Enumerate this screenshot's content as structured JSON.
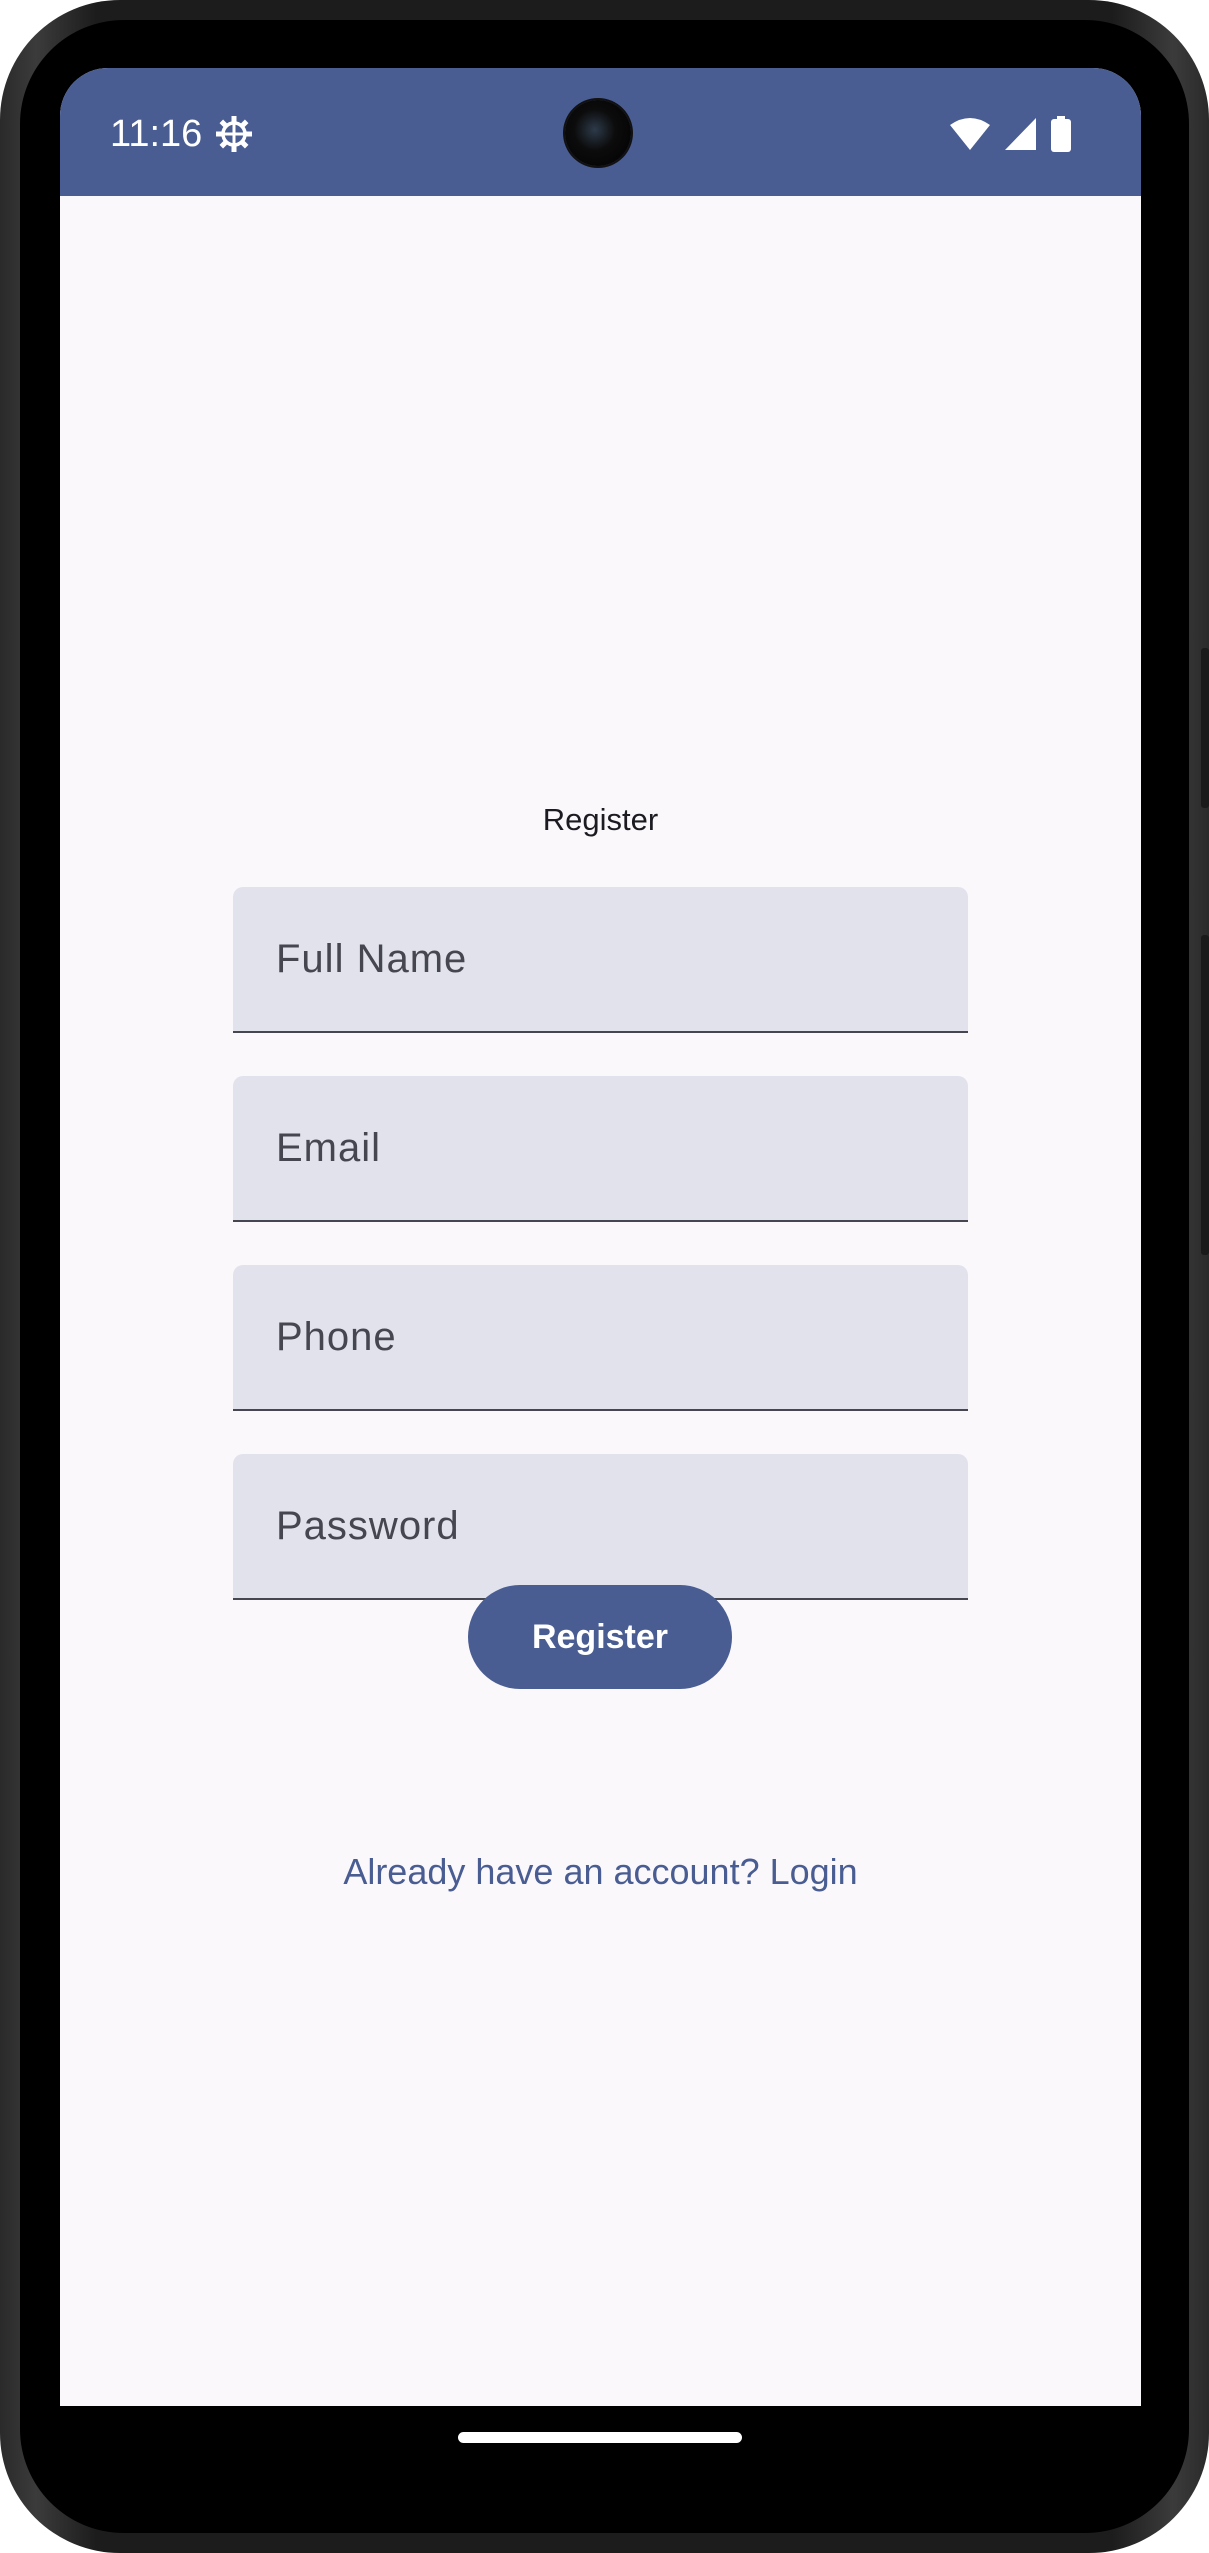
{
  "status_bar": {
    "time": "11:16",
    "left_icons": [
      "settings-icon"
    ],
    "right_icons": [
      "wifi-icon",
      "cell-signal-icon",
      "battery-icon"
    ],
    "color": "#495d92"
  },
  "screen": {
    "title": "Register",
    "fields": [
      {
        "name": "full-name",
        "placeholder": "Full Name",
        "value": ""
      },
      {
        "name": "email",
        "placeholder": "Email",
        "value": ""
      },
      {
        "name": "phone",
        "placeholder": "Phone",
        "value": ""
      },
      {
        "name": "password",
        "placeholder": "Password",
        "value": ""
      }
    ],
    "register_button": "Register",
    "login_link": "Already have an account? Login"
  },
  "colors": {
    "primary": "#495d92",
    "background": "#fbf8fc",
    "field_fill": "#e1e2ec",
    "field_underline": "#45464f"
  }
}
